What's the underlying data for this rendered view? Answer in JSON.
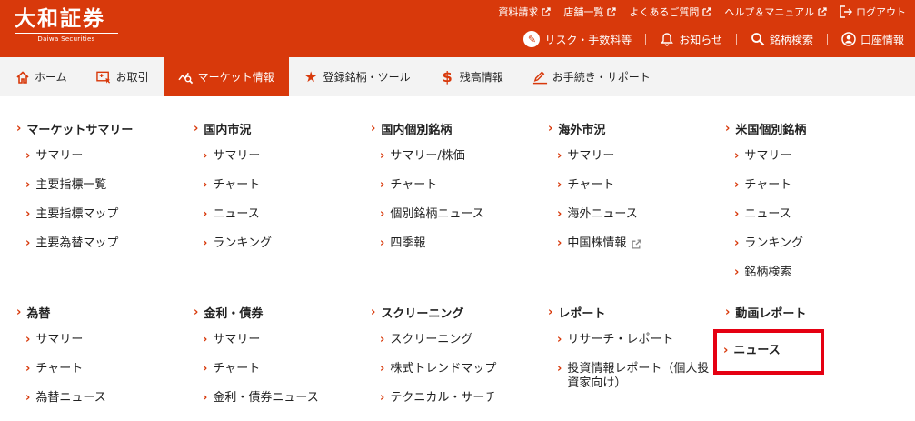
{
  "header": {
    "logo_main": "大和証券",
    "logo_sub": "Daiwa Securities",
    "toplinks": [
      "資料請求",
      "店舗一覧",
      "よくあるご質問",
      "ヘルプ＆マニュアル"
    ],
    "logout": "ログアウト",
    "sub": {
      "risk": "リスク・手数料等",
      "news": "お知らせ",
      "search": "銘柄検索",
      "account": "口座情報"
    }
  },
  "nav": [
    "ホーム",
    "お取引",
    "マーケット情報",
    "登録銘柄・ツール",
    "残高情報",
    "お手続き・サポート"
  ],
  "menu": {
    "row1": [
      {
        "title": "マーケットサマリー",
        "items": [
          "サマリー",
          "主要指標一覧",
          "主要指標マップ",
          "主要為替マップ"
        ]
      },
      {
        "title": "国内市況",
        "items": [
          "サマリー",
          "チャート",
          "ニュース",
          "ランキング"
        ]
      },
      {
        "title": "国内個別銘柄",
        "items": [
          "サマリー/株価",
          "チャート",
          "個別銘柄ニュース",
          "四季報"
        ]
      },
      {
        "title": "海外市況",
        "items": [
          "サマリー",
          "チャート",
          "海外ニュース",
          "中国株情報"
        ]
      },
      {
        "title": "米国個別銘柄",
        "items": [
          "サマリー",
          "チャート",
          "ニュース",
          "ランキング",
          "銘柄検索"
        ]
      }
    ],
    "row2": [
      {
        "title": "為替",
        "items": [
          "サマリー",
          "チャート",
          "為替ニュース"
        ]
      },
      {
        "title": "金利・債券",
        "items": [
          "サマリー",
          "チャート",
          "金利・債券ニュース"
        ]
      },
      {
        "title": "スクリーニング",
        "items": [
          "スクリーニング",
          "株式トレンドマップ",
          "テクニカル・サーチ"
        ]
      },
      {
        "title": "レポート",
        "items": [
          "リサーチ・レポート",
          "投資情報レポート（個人投資家向け）"
        ]
      },
      {
        "title": "動画レポート",
        "items": [
          "ニュース"
        ]
      }
    ]
  }
}
